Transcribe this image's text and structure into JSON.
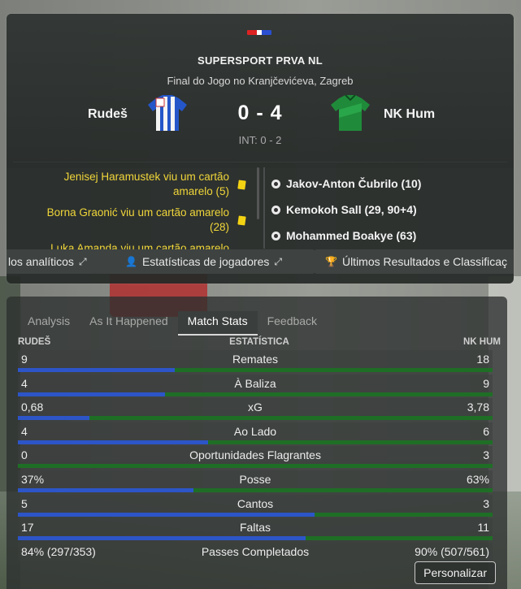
{
  "match": {
    "competition": "SUPERSPORT PRVA NL",
    "venue_line": "Final do Jogo no Kranjčevićeva, Zagreb",
    "home_team": "Rudeš",
    "away_team": "NK Hum",
    "score": "0 - 4",
    "halftime": "INT: 0 - 2"
  },
  "events": {
    "home_cards": [
      {
        "text": "Jenisej Haramustek viu um cartão amarelo (5)"
      },
      {
        "text": "Borna Graonić viu um cartão amarelo (28)"
      },
      {
        "text": "Luka Amanda viu um cartão amarelo"
      }
    ],
    "away_goals": [
      {
        "text": "Jakov-Anton Čubrilo (10)"
      },
      {
        "text": "Kemokoh Sall (29, 90+4)"
      },
      {
        "text": "Mohammed Boakye (63)"
      }
    ]
  },
  "nav_buttons": {
    "b1": "los analíticos",
    "b2": "Estatísticas de jogadores",
    "b3": "Últimos Resultados e Classificaç"
  },
  "tabs": [
    "Analysis",
    "As It Happened",
    "Match Stats",
    "Feedback"
  ],
  "active_tab": "Match Stats",
  "stats_header": {
    "home": "RUDEŠ",
    "middle": "ESTATÍSTICA",
    "away": "NK HUM"
  },
  "stats": [
    {
      "label": "Remates",
      "home": "9",
      "away": "18",
      "home_share": 0.33
    },
    {
      "label": "À Baliza",
      "home": "4",
      "away": "9",
      "home_share": 0.31
    },
    {
      "label": "xG",
      "home": "0,68",
      "away": "3,78",
      "home_share": 0.15
    },
    {
      "label": "Ao Lado",
      "home": "4",
      "away": "6",
      "home_share": 0.4
    },
    {
      "label": "Oportunidades Flagrantes",
      "home": "0",
      "away": "3",
      "home_share": 0.0
    },
    {
      "label": "Posse",
      "home": "37%",
      "away": "63%",
      "home_share": 0.37
    },
    {
      "label": "Cantos",
      "home": "5",
      "away": "3",
      "home_share": 0.625
    },
    {
      "label": "Faltas",
      "home": "17",
      "away": "11",
      "home_share": 0.607
    },
    {
      "label": "Passes Completados",
      "home": "84% (297/353)",
      "away": "90% (507/561)",
      "home_share": null
    }
  ],
  "customize_button": "Personalizar",
  "colors": {
    "home_bar": "#2d55c8",
    "away_bar": "#1f6e26",
    "card_yellow": "#f4d313"
  }
}
